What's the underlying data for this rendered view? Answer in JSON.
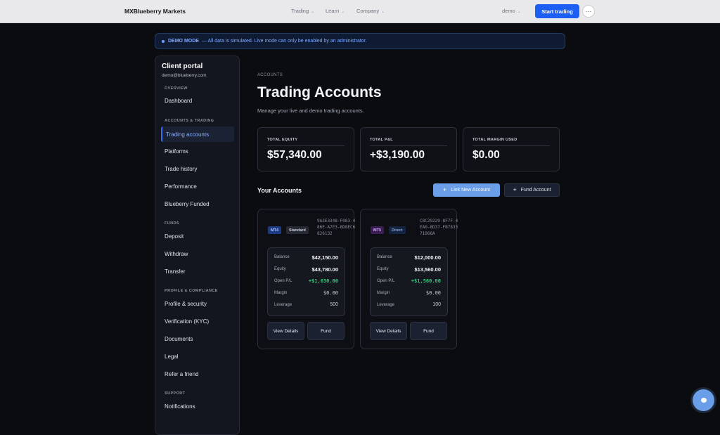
{
  "topbar": {
    "brand": "MXBlueberry Markets",
    "nav": [
      {
        "label": "Trading"
      },
      {
        "label": "Learn"
      },
      {
        "label": "Company"
      }
    ],
    "account_select": "demo",
    "start_label": "Start trading",
    "more_label": "···"
  },
  "banner": {
    "mode": "DEMO MODE",
    "text": "— All data is simulated. Live mode can only be enabled by an administrator."
  },
  "sidebar": {
    "title": "Client portal",
    "email": "demo@blueberry.com",
    "sections": [
      {
        "label": "OVERVIEW"
      },
      {
        "label": "ACCOUNTS & TRADING"
      },
      {
        "label": "FUNDS"
      },
      {
        "label": "PROFILE & COMPLIANCE"
      },
      {
        "label": "SUPPORT"
      }
    ],
    "items": [
      {
        "label": "Dashboard"
      },
      {
        "label": "Trading accounts"
      },
      {
        "label": "Platforms"
      },
      {
        "label": "Trade history"
      },
      {
        "label": "Performance"
      },
      {
        "label": "Blueberry Funded"
      },
      {
        "label": "Deposit"
      },
      {
        "label": "Withdraw"
      },
      {
        "label": "Transfer"
      },
      {
        "label": "Profile & security"
      },
      {
        "label": "Verification (KYC)"
      },
      {
        "label": "Documents"
      },
      {
        "label": "Legal"
      },
      {
        "label": "Refer a friend"
      },
      {
        "label": "Notifications"
      }
    ]
  },
  "main": {
    "breadcrumb": "ACCOUNTS",
    "title": "Trading Accounts",
    "subtitle": "Manage your live and demo trading accounts.",
    "stats": [
      {
        "label": "TOTAL EQUITY",
        "value": "$57,340.00"
      },
      {
        "label": "TOTAL P&L",
        "value": "+$3,190.00"
      },
      {
        "label": "TOTAL MARGIN USED",
        "value": "$0.00"
      }
    ],
    "accounts_heading": "Your Accounts",
    "link_label": "Link New Account",
    "fund_label": "Fund Account",
    "accounts": [
      {
        "platform": "MT4",
        "type": "Standard",
        "id": "9A3E3348-F083-486E-A7E3-8D8EC6826132",
        "fields": [
          {
            "label": "Balance",
            "value": "$42,150.00"
          },
          {
            "label": "Equity",
            "value": "$43,780.00"
          },
          {
            "label": "Open P/L",
            "value": "+$1,630.00"
          },
          {
            "label": "Margin",
            "value": "$0.00"
          },
          {
            "label": "Leverage",
            "value": "500"
          }
        ],
        "view_label": "View Details",
        "fund_label": "Fund"
      },
      {
        "platform": "MT5",
        "type": "Direct",
        "id": "C8C29229-8F7F-4EA0-8D37-FB783371D68A",
        "fields": [
          {
            "label": "Balance",
            "value": "$12,000.00"
          },
          {
            "label": "Equity",
            "value": "$13,560.00"
          },
          {
            "label": "Open P/L",
            "value": "+$1,560.00"
          },
          {
            "label": "Margin",
            "value": "$0.00"
          },
          {
            "label": "Leverage",
            "value": "100"
          }
        ],
        "view_label": "View Details",
        "fund_label": "Fund"
      }
    ]
  },
  "colors": {
    "accent": "#1d5ff2",
    "positive": "#2ecc7a",
    "background": "#0b0c10"
  },
  "icons": [
    "chevron-down-icon",
    "plus-icon",
    "chat-icon",
    "more-icon"
  ]
}
